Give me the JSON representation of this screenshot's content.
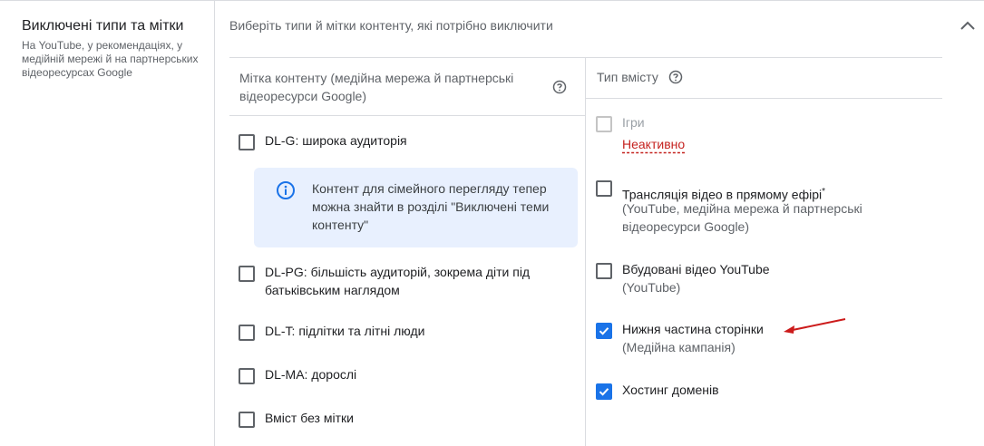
{
  "section": {
    "title": "Виключені типи та мітки",
    "description": "На YouTube, у рекомендаціях, у медійній мережі й на партнерських відеоресурсах Google"
  },
  "intro": "Виберіть типи й мітки контенту, які потрібно виключити",
  "labels_column": {
    "header": "Мітка контенту (медійна мережа й партнерські відеоресурси Google)",
    "items": [
      {
        "label": "DL-G: широка аудиторія",
        "checked": false
      },
      {
        "label": "DL-PG: більшість аудиторій, зокрема діти під батьківським наглядом",
        "checked": false
      },
      {
        "label": "DL-T: підлітки та літні люди",
        "checked": false
      },
      {
        "label": "DL-MA: дорослі",
        "checked": false
      },
      {
        "label": "Вміст без мітки",
        "checked": false
      }
    ],
    "notice": {
      "icon": "info-icon",
      "text": "Контент для сімейного перегляду тепер можна знайти в розділі \"Виключені теми контенту\""
    }
  },
  "types_column": {
    "header": "Тип вмісту",
    "items": [
      {
        "label": "Ігри",
        "status": "Неактивно",
        "checked": false,
        "disabled": true
      },
      {
        "label": "Трансляція відео в прямому ефірі",
        "marker": "*",
        "sublabel": "(YouTube, медійна мережа й партнерські відеоресурси Google)",
        "checked": false
      },
      {
        "label": "Вбудовані відео YouTube",
        "sublabel": "(YouTube)",
        "checked": false
      },
      {
        "label": "Нижня частина сторінки",
        "sublabel": "(Медійна кампанія)",
        "checked": true
      },
      {
        "label": "Хостинг доменів",
        "checked": true
      }
    ]
  },
  "colors": {
    "accent": "#1a73e8",
    "error": "#c5221f",
    "notice_bg": "#e8f0fe",
    "annotation_arrow": "#cc1b1b"
  }
}
